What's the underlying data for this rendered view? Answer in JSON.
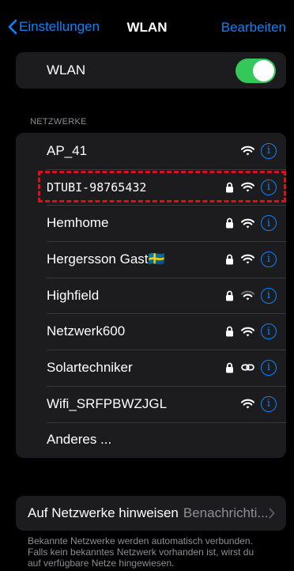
{
  "nav": {
    "back_label": "Einstellungen",
    "title": "WLAN",
    "edit_label": "Bearbeiten"
  },
  "wlan": {
    "label": "WLAN",
    "enabled": true,
    "toggle_color": "#34c759"
  },
  "networks": {
    "header": "NETZWERKE",
    "items": [
      {
        "name": "AP_41",
        "locked": false,
        "signal": "wifi-icon"
      },
      {
        "name": "DTUBI-98765432",
        "locked": true,
        "signal": "wifi-icon"
      },
      {
        "name": "Hemhome",
        "locked": true,
        "signal": "wifi-icon"
      },
      {
        "name": "Hergersson Gast🇸🇪",
        "locked": true,
        "signal": "wifi-icon"
      },
      {
        "name": "Highfield",
        "locked": true,
        "signal": "wifi-weak-icon"
      },
      {
        "name": "Netzwerk600",
        "locked": true,
        "signal": "wifi-icon"
      },
      {
        "name": "Solartechniker",
        "locked": true,
        "signal": "link-icon"
      },
      {
        "name": "Wifi_SRFPBWZJGL",
        "locked": false,
        "signal": "wifi-icon"
      }
    ],
    "other_label": "Anderes ..."
  },
  "notify": {
    "label": "Auf Netzwerke hinweisen",
    "value": "Benachrichti..."
  },
  "footer": {
    "line1": "Bekannte Netzwerke werden automatisch verbunden.",
    "line2": "Falls kein bekanntes Netzwerk vorhanden ist, wirst du",
    "line3": "auf verfügbare Netze hingewiesen."
  },
  "colors": {
    "accent": "#0a84ff",
    "highlight": "#e0101a",
    "cell_bg": "#1c1c1e"
  }
}
